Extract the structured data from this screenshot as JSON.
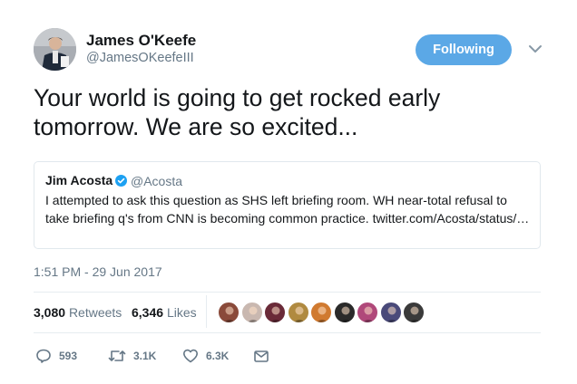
{
  "header": {
    "display_name": "James O'Keefe",
    "handle": "@JamesOKeefeIII",
    "follow_label": "Following",
    "colors": {
      "accent": "#5ba8e6",
      "secondary_text": "#657786"
    }
  },
  "tweet": {
    "text": "Your world is going to get rocked early tomorrow. We are so excited...",
    "timestamp": "1:51 PM - 29 Jun 2017"
  },
  "quoted_tweet": {
    "display_name": "Jim Acosta",
    "verified_icon": "verified-badge-icon",
    "handle": "@Acosta",
    "text": "I attempted to ask this question as SHS left briefing room. WH near-total refusal to take briefing q's from CNN is becoming common practice. twitter.com/Acosta/status/…"
  },
  "stats": {
    "retweets_count": "3,080",
    "retweets_label": "Retweets",
    "likes_count": "6,346",
    "likes_label": "Likes"
  },
  "likers": [
    {
      "name": "liker-avatar-1",
      "color": "#8a4a3a"
    },
    {
      "name": "liker-avatar-2",
      "color": "#c9b8b0"
    },
    {
      "name": "liker-avatar-3",
      "color": "#6a2a38"
    },
    {
      "name": "liker-avatar-4",
      "color": "#b08a40"
    },
    {
      "name": "liker-avatar-5",
      "color": "#d07a30"
    },
    {
      "name": "liker-avatar-6",
      "color": "#2a2a2a"
    },
    {
      "name": "liker-avatar-7",
      "color": "#b0487a"
    },
    {
      "name": "liker-avatar-8",
      "color": "#4a4a7a"
    },
    {
      "name": "liker-avatar-9",
      "color": "#3a3a3a"
    }
  ],
  "actions": {
    "reply": {
      "icon": "reply-icon",
      "count": "593"
    },
    "retweet": {
      "icon": "retweet-icon",
      "count": "3.1K"
    },
    "like": {
      "icon": "heart-icon",
      "count": "6.3K"
    },
    "message": {
      "icon": "direct-message-icon"
    }
  }
}
